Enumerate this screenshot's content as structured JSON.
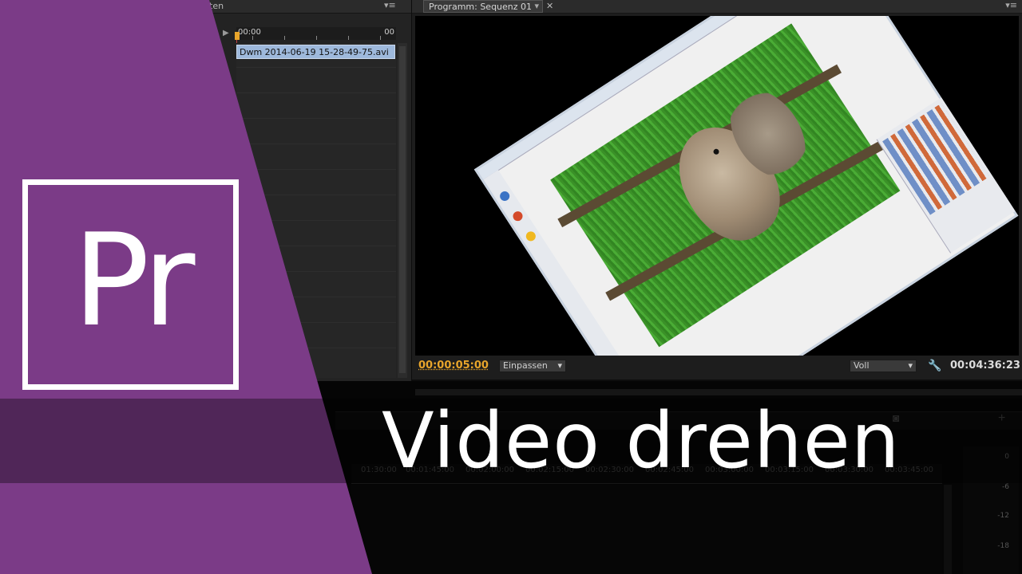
{
  "project_panel": {
    "tab_label": "ten",
    "ruler_start": "00:00",
    "ruler_end": "00",
    "clip_name": "Dwm 2014-06-19 15-28-49-75.avi"
  },
  "program_monitor": {
    "tab_label": "Programm: Sequenz 01",
    "current_time": "00:00:05:00",
    "fit_select": "Einpassen",
    "quality_select": "Voll",
    "duration": "00:04:36:23"
  },
  "timeline": {
    "time_labels": [
      "01:30:00",
      "00:01:45:00",
      "00:02:00:00",
      "00:02:15:00",
      "00:02:30:00",
      "00:02:45:00",
      "00:03:00:00",
      "00:03:15:00",
      "00:03:30:00",
      "00:03:45:00"
    ]
  },
  "audio_meter": {
    "labels": [
      "0",
      "-6",
      "-12",
      "-18"
    ]
  },
  "overlay": {
    "logo_text": "Pr",
    "title": "Video drehen"
  },
  "colors": {
    "brand_purple": "#7b3b87",
    "timecode_orange": "#e8a52b",
    "clip_blue": "#9eb9dc"
  },
  "icons": {
    "panel_menu": "panel-menu-icon",
    "play": "play-icon",
    "wrench": "wrench-icon",
    "camera": "camera-icon",
    "add": "plus-icon"
  }
}
